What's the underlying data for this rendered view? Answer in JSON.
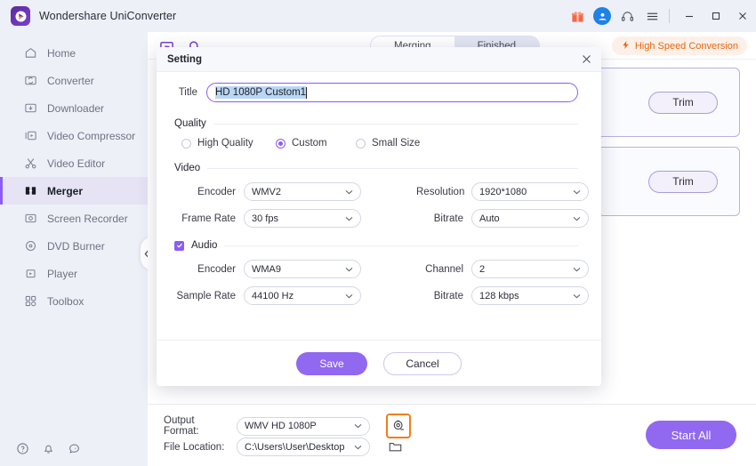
{
  "window": {
    "app_title": "Wondershare UniConverter",
    "logo_icon": "uniconverter-logo-icon",
    "toolbar_icons": [
      "gift-icon",
      "user-avatar-icon",
      "headset-support-icon",
      "hamburger-menu-icon"
    ],
    "minimize_label": "—",
    "maximize_label": "□",
    "close_label": "✕"
  },
  "sidebar": {
    "items": [
      {
        "label": "Home",
        "icon": "home-icon",
        "active": false
      },
      {
        "label": "Converter",
        "icon": "converter-icon",
        "active": false
      },
      {
        "label": "Downloader",
        "icon": "downloader-icon",
        "active": false
      },
      {
        "label": "Video Compressor",
        "icon": "video-compressor-icon",
        "active": false
      },
      {
        "label": "Video Editor",
        "icon": "scissors-icon",
        "active": false
      },
      {
        "label": "Merger",
        "icon": "merger-icon",
        "active": true
      },
      {
        "label": "Screen Recorder",
        "icon": "screen-recorder-icon",
        "active": false
      },
      {
        "label": "DVD Burner",
        "icon": "dvd-burner-icon",
        "active": false
      },
      {
        "label": "Player",
        "icon": "player-icon",
        "active": false
      },
      {
        "label": "Toolbox",
        "icon": "toolbox-icon",
        "active": false
      }
    ],
    "collapse_icon": "chevron-left-icon",
    "bottom_icons": [
      "help-icon",
      "notification-bell-icon",
      "feedback-icon"
    ]
  },
  "main": {
    "header_icons": [
      "add-files-icon",
      "add-folder-icon"
    ],
    "tabs": [
      {
        "label": "Merging",
        "selected": false
      },
      {
        "label": "Finished",
        "selected": true
      }
    ],
    "high_speed_badge": {
      "label": "High Speed Conversion",
      "icon": "lightning-bolt-icon",
      "color": "#e8650d"
    },
    "cards": [
      {
        "trim_label": "Trim"
      },
      {
        "trim_label": "Trim"
      }
    ]
  },
  "output_bar": {
    "format_label": "Output Format:",
    "format_value": "WMV HD 1080P",
    "location_label": "File Location:",
    "location_value": "C:\\Users\\User\\Desktop",
    "settings_button_icon": "output-settings-icon",
    "settings_highlight_color": "#ef7f1a",
    "folder_button_icon": "folder-icon",
    "start_all_label": "Start All",
    "chevron_icon": "chevron-down-icon"
  },
  "dialog": {
    "title": "Setting",
    "close_icon": "close-icon",
    "title_field": {
      "label": "Title",
      "value": "HD 1080P Custom1",
      "selected": true
    },
    "quality": {
      "section_label": "Quality",
      "options": [
        {
          "label": "High Quality",
          "selected": false
        },
        {
          "label": "Custom",
          "selected": true
        },
        {
          "label": "Small Size",
          "selected": false
        }
      ]
    },
    "video": {
      "section_label": "Video",
      "fields": [
        {
          "label": "Encoder",
          "value": "WMV2"
        },
        {
          "label": "Resolution",
          "value": "1920*1080"
        },
        {
          "label": "Frame Rate",
          "value": "30 fps"
        },
        {
          "label": "Bitrate",
          "value": "Auto"
        }
      ]
    },
    "audio": {
      "section_label": "Audio",
      "enabled": true,
      "check_icon": "checkmark-icon",
      "fields": [
        {
          "label": "Encoder",
          "value": "WMA9"
        },
        {
          "label": "Channel",
          "value": "2"
        },
        {
          "label": "Sample Rate",
          "value": "44100 Hz"
        },
        {
          "label": "Bitrate",
          "value": "128 kbps"
        }
      ]
    },
    "save_label": "Save",
    "cancel_label": "Cancel",
    "accent_color": "#8b5cf6"
  }
}
